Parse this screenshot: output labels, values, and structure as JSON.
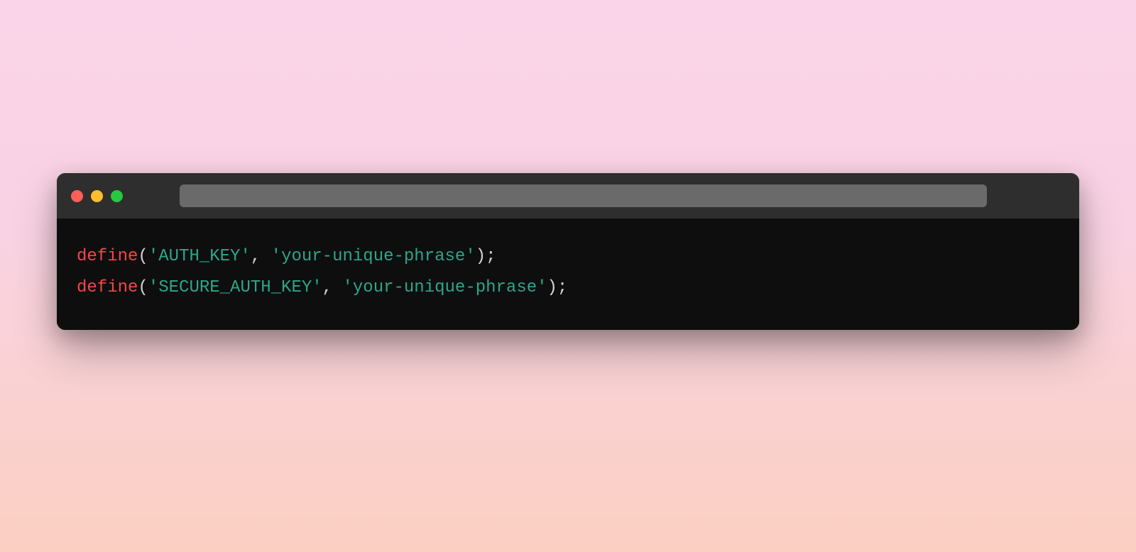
{
  "window": {
    "traffic_lights": {
      "red": "#ff5f57",
      "yellow": "#febc2e",
      "green": "#28c840"
    },
    "url_value": ""
  },
  "code": {
    "lines": [
      {
        "tokens": [
          {
            "cls": "tok-keyword",
            "text": "define"
          },
          {
            "cls": "tok-punct",
            "text": "("
          },
          {
            "cls": "tok-string",
            "text": "'AUTH_KEY'"
          },
          {
            "cls": "tok-punct",
            "text": ", "
          },
          {
            "cls": "tok-string",
            "text": "'your-unique-phrase'"
          },
          {
            "cls": "tok-punct",
            "text": ");"
          }
        ]
      },
      {
        "tokens": [
          {
            "cls": "tok-keyword",
            "text": "define"
          },
          {
            "cls": "tok-punct",
            "text": "("
          },
          {
            "cls": "tok-string",
            "text": "'SECURE_AUTH_KEY'"
          },
          {
            "cls": "tok-punct",
            "text": ", "
          },
          {
            "cls": "tok-string",
            "text": "'your-unique-phrase'"
          },
          {
            "cls": "tok-punct",
            "text": ");"
          }
        ]
      }
    ]
  }
}
